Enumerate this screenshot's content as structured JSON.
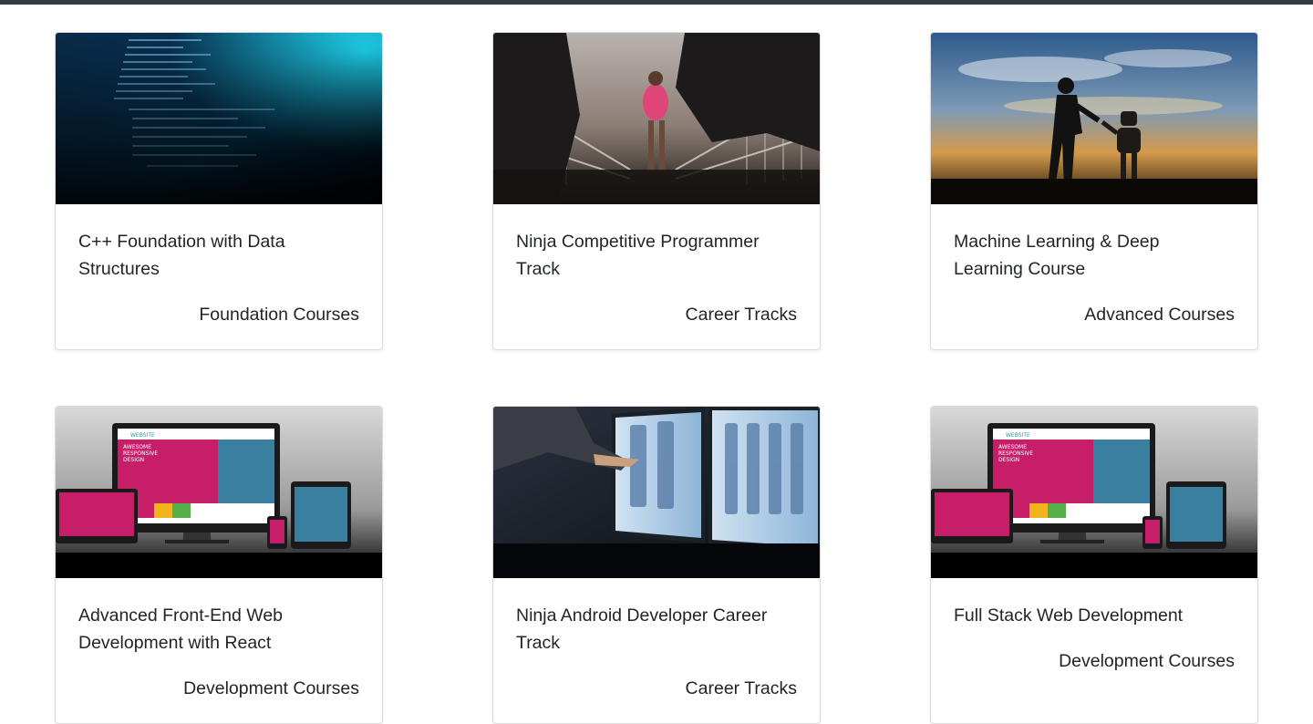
{
  "courses": [
    {
      "title": "C++ Foundation with Data Structures",
      "category": "Foundation Courses",
      "image": "code-screen-image"
    },
    {
      "title": "Ninja Competitive Programmer Track",
      "category": "Career Tracks",
      "image": "runners-image"
    },
    {
      "title": "Machine Learning & Deep Learning Course",
      "category": "Advanced Courses",
      "image": "human-robot-handshake-image"
    },
    {
      "title": "Advanced Front-End Web Development with React",
      "category": "Development Courses",
      "image": "responsive-devices-image"
    },
    {
      "title": "Ninja Android Developer Career Track",
      "category": "Career Tracks",
      "image": "app-design-monitor-image"
    },
    {
      "title": "Full Stack Web Development",
      "category": "Development Courses",
      "image": "responsive-devices-image"
    }
  ],
  "thumb_text": {
    "site_label": "WEBSITE",
    "headline_line1": "AWESOME",
    "headline_line2": "RESPONSIVE",
    "headline_line3": "DESIGN"
  }
}
